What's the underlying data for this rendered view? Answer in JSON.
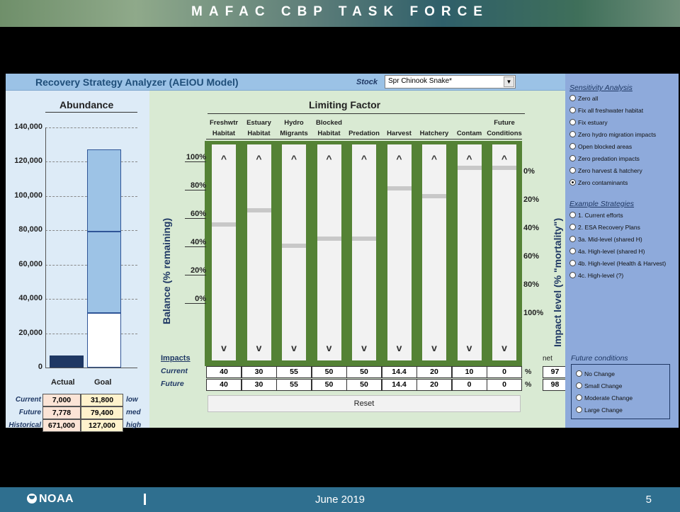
{
  "slide": {
    "title": "MAFAC CBP TASK FORCE",
    "date": "June 2019",
    "page": "5",
    "logo": "NOAA"
  },
  "header": {
    "app_title": "Recovery Strategy Analyzer  (AEIOU Model)",
    "stock_label": "Stock",
    "stock_value": "Spr Chinook Snake*"
  },
  "abundance": {
    "title": "Abundance",
    "y_ticks": [
      "140,000",
      "120,000",
      "100,000",
      "80,000",
      "60,000",
      "40,000",
      "20,000",
      "0"
    ],
    "categories": [
      "Actual",
      "Goal"
    ],
    "rows": [
      {
        "label": "Current",
        "actual": "7,000",
        "goal": "31,800",
        "level": "low"
      },
      {
        "label": "Future",
        "actual": "7,778",
        "goal": "79,400",
        "level": "med"
      },
      {
        "label": "Historical",
        "actual": "671,000",
        "goal": "127,000",
        "level": "high"
      }
    ]
  },
  "chart_data": {
    "type": "bar",
    "title": "Abundance",
    "categories": [
      "Actual",
      "Goal"
    ],
    "series": [
      {
        "name": "low",
        "values": [
          7000,
          31800
        ]
      },
      {
        "name": "med",
        "values": [
          7778,
          79400
        ]
      },
      {
        "name": "high",
        "values": [
          671000,
          127000
        ]
      }
    ],
    "ylim": [
      0,
      140000
    ]
  },
  "limiting": {
    "title": "Limiting Factor",
    "balance_label": "Balance (% remaining)",
    "impact_label": "Impact level (% \"mortality\")",
    "balance_ticks": [
      "100%",
      "80%",
      "60%",
      "40%",
      "20%",
      "0%"
    ],
    "impact_ticks": [
      "0%",
      "20%",
      "40%",
      "60%",
      "80%",
      "100%"
    ],
    "columns": [
      {
        "h1": "Freshwtr",
        "h2": "Habitat",
        "current": "40",
        "future": "40",
        "balance": 0.6
      },
      {
        "h1": "Estuary",
        "h2": "Habitat",
        "current": "30",
        "future": "30",
        "balance": 0.7
      },
      {
        "h1": "Hydro",
        "h2": "Migrants",
        "current": "55",
        "future": "55",
        "balance": 0.45
      },
      {
        "h1": "Blocked",
        "h2": "Habitat",
        "current": "50",
        "future": "50",
        "balance": 0.5
      },
      {
        "h1": "",
        "h2": "Predation",
        "current": "50",
        "future": "50",
        "balance": 0.5
      },
      {
        "h1": "",
        "h2": "Harvest",
        "current": "14.4",
        "future": "14.4",
        "balance": 0.856
      },
      {
        "h1": "",
        "h2": "Hatchery",
        "current": "20",
        "future": "20",
        "balance": 0.8
      },
      {
        "h1": "",
        "h2": "Contam",
        "current": "10",
        "future": "0",
        "balance": 1.0
      },
      {
        "h1": "Future",
        "h2": "Conditions",
        "current": "0",
        "future": "0",
        "balance": 1.0
      }
    ],
    "impacts_label": "Impacts",
    "current_label": "Current",
    "future_label": "Future",
    "pct": "%",
    "net_label": "net",
    "net_current": "97",
    "net_future": "98",
    "reset_label": "Reset",
    "up_glyph": "^",
    "down_glyph": "v"
  },
  "sensitivity": {
    "title": "Sensitivity Analysis",
    "options": [
      "Zero all",
      "Fix all freshwater habitat",
      "Fix estuary",
      "Zero hydro migration impacts",
      "Open blocked areas",
      "Zero predation impacts",
      "Zero harvest & hatchery",
      "Zero contaminants"
    ],
    "selected": 7
  },
  "strategies": {
    "title": "Example Strategies",
    "options": [
      "1. Current efforts",
      "2. ESA Recovery Plans",
      "3a. Mid-level  (shared H)",
      "4a. High-level (shared H)",
      "4b. High-level (Health & Harvest)",
      "4c. High-level (?)"
    ]
  },
  "future": {
    "title": "Future conditions",
    "options": [
      "No Change",
      "Small Change",
      "Moderate Change",
      "Large Change"
    ]
  }
}
